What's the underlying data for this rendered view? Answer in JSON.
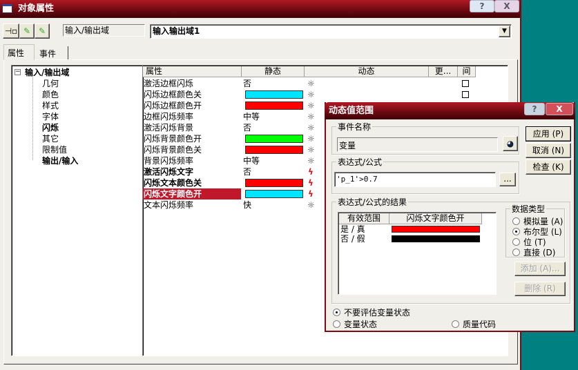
{
  "window": {
    "title": "对象属性",
    "help": "?",
    "close": "X"
  },
  "toolbar": {
    "pin_icon": "pin-icon",
    "pipette_icon": "pipette-icon",
    "type_label": "输入/输出域",
    "object_name": "输入输出域1"
  },
  "tabs": [
    {
      "label": "属性",
      "active": true
    },
    {
      "label": "事件",
      "active": false
    }
  ],
  "tree": {
    "root": "输入/输出域",
    "items": [
      {
        "label": "几何",
        "bold": false
      },
      {
        "label": "颜色",
        "bold": false
      },
      {
        "label": "样式",
        "bold": false
      },
      {
        "label": "字体",
        "bold": false
      },
      {
        "label": "闪烁",
        "bold": true
      },
      {
        "label": "其它",
        "bold": false
      },
      {
        "label": "限制值",
        "bold": false
      },
      {
        "label": "输出/输入",
        "bold": true
      }
    ]
  },
  "grid": {
    "headers": [
      "属性",
      "静态",
      "动态",
      "更...",
      "间"
    ],
    "rows": [
      {
        "name": "激活边框闪烁",
        "static": "否",
        "dynamic": "bulb",
        "bold": false
      },
      {
        "name": "闪烁边框颜色关",
        "color": "#00e5ff",
        "dynamic": "bulb",
        "bold": false
      },
      {
        "name": "闪烁边框颜色开",
        "color": "#ff0000",
        "dynamic": "bulb",
        "bold": false
      },
      {
        "name": "边框闪烁频率",
        "static": "中等",
        "dynamic": "bulb",
        "bold": false
      },
      {
        "name": "激活闪烁背景",
        "static": "否",
        "dynamic": "bulb",
        "bold": false
      },
      {
        "name": "闪烁背景颜色开",
        "color": "#00ff00",
        "dynamic": "bulb",
        "bold": false
      },
      {
        "name": "闪烁背景颜色关",
        "color": "#ff0000",
        "dynamic": "bulb",
        "bold": false
      },
      {
        "name": "背景闪烁频率",
        "static": "中等",
        "dynamic": "bulb",
        "bold": false
      },
      {
        "name": "激活闪烁文字",
        "static": "否",
        "dynamic": "bolt",
        "bold": true
      },
      {
        "name": "闪烁文本颜色关",
        "color": "#ff0000",
        "dynamic": "bolt",
        "bold": true
      },
      {
        "name": "闪烁文字颜色开",
        "color": "#00e5ff",
        "dynamic": "bolt",
        "bold": true,
        "selected": true
      },
      {
        "name": "文本闪烁频率",
        "static": "快",
        "dynamic": "bulb",
        "bold": false
      }
    ]
  },
  "dialog": {
    "title": "动态值范围",
    "help": "?",
    "close": "X",
    "event_group": "事件名称",
    "event_value": "变量",
    "expr_group": "表达式/公式",
    "expr_value": "'p_1'>0.7",
    "browse": "...",
    "result_group": "表达式/公式的结果",
    "result_headers": [
      "有效范围",
      "闪烁文字颜色开"
    ],
    "results": [
      {
        "range": "是 / 真",
        "color": "#ff0000"
      },
      {
        "range": "否 / 假",
        "color": "#000000"
      }
    ],
    "datatype_group": "数据类型",
    "datatypes": [
      {
        "label": "模拟量 (A)",
        "checked": false
      },
      {
        "label": "布尔型 (L)",
        "checked": true
      },
      {
        "label": "位 (T)",
        "checked": false
      },
      {
        "label": "直接 (D)",
        "checked": false
      }
    ],
    "buttons": {
      "apply": "应用 (P)",
      "cancel": "取消 (N)",
      "check": "检查 (K)",
      "add": "添加 (A)...",
      "delete": "删除 (R)"
    },
    "options": [
      {
        "label": "不要评估变量状态",
        "checked": true
      },
      {
        "label": "变量状态",
        "checked": false
      },
      {
        "label": "质量代码",
        "checked": false
      }
    ]
  },
  "colors": {
    "titlebar": "#7a0b12",
    "selection": "#c0182a",
    "desktop": "#008080"
  }
}
